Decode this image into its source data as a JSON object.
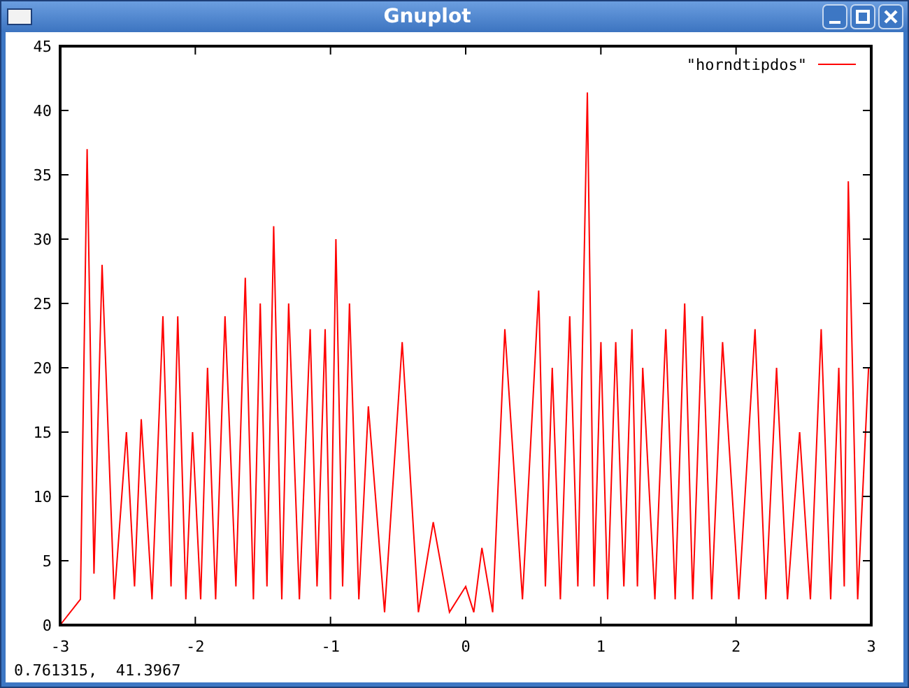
{
  "window": {
    "title": "Gnuplot"
  },
  "plot": {
    "chart_data": {
      "type": "line",
      "xlim": [
        -3,
        3
      ],
      "ylim": [
        0,
        45
      ],
      "xticks": [
        -3,
        -2,
        -1,
        0,
        1,
        2,
        3
      ],
      "yticks": [
        0,
        5,
        10,
        15,
        20,
        25,
        30,
        35,
        40,
        45
      ],
      "x": [
        -3,
        -2.85,
        -2.8,
        -2.75,
        -2.69,
        -2.6,
        -2.51,
        -2.45,
        -2.4,
        -2.32,
        -2.24,
        -2.18,
        -2.13,
        -2.07,
        -2.02,
        -1.96,
        -1.91,
        -1.85,
        -1.78,
        -1.7,
        -1.63,
        -1.57,
        -1.52,
        -1.47,
        -1.42,
        -1.36,
        -1.31,
        -1.23,
        -1.15,
        -1.1,
        -1.04,
        -1.0,
        -0.96,
        -0.91,
        -0.86,
        -0.79,
        -0.72,
        -0.6,
        -0.47,
        -0.35,
        -0.24,
        -0.12,
        0,
        0.06,
        0.12,
        0.2,
        0.29,
        0.42,
        0.54,
        0.59,
        0.64,
        0.7,
        0.77,
        0.83,
        0.9,
        0.95,
        1.0,
        1.05,
        1.11,
        1.17,
        1.23,
        1.27,
        1.31,
        1.4,
        1.48,
        1.55,
        1.62,
        1.68,
        1.75,
        1.82,
        1.9,
        2.02,
        2.14,
        2.22,
        2.3,
        2.38,
        2.47,
        2.55,
        2.63,
        2.7,
        2.76,
        2.8,
        2.83,
        2.9,
        2.98,
        3
      ],
      "series": [
        {
          "name": "\"horndtipdos\"",
          "color": "#ff0000",
          "values": [
            0,
            2,
            37,
            4,
            28,
            2,
            15,
            3,
            16,
            2,
            24,
            3,
            24,
            2,
            15,
            2,
            20,
            2,
            24,
            3,
            27,
            2,
            25,
            3,
            31,
            2,
            25,
            2,
            23,
            3,
            23,
            2,
            30,
            3,
            25,
            2,
            17,
            1,
            22,
            1,
            8,
            1,
            3,
            1,
            6,
            1,
            23,
            2,
            26,
            3,
            20,
            2,
            24,
            3,
            41.4,
            3,
            22,
            2,
            22,
            3,
            23,
            3,
            20,
            2,
            23,
            2,
            25,
            2,
            24,
            2,
            22,
            2,
            23,
            2,
            20,
            2,
            15,
            2,
            23,
            2,
            20,
            3,
            34.5,
            2,
            20,
            20
          ]
        }
      ]
    }
  },
  "status_bar": "0.761315,  41.3967"
}
